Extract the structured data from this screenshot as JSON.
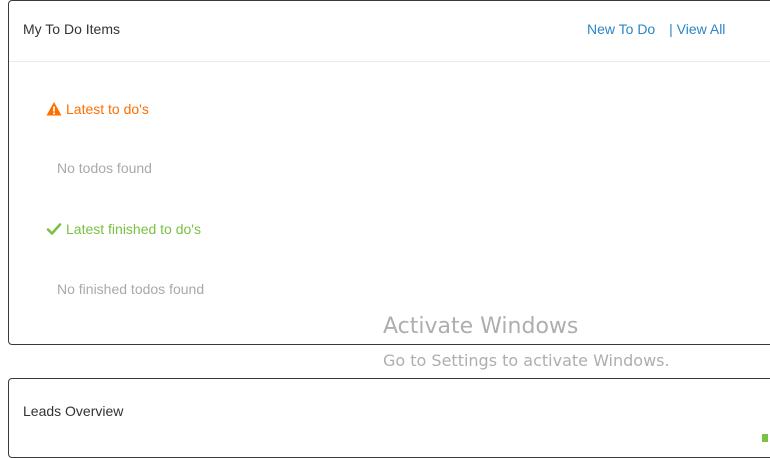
{
  "todo_panel": {
    "title": "My To Do Items",
    "new_link": "New To Do",
    "separator": "|",
    "view_all_link": "View All",
    "latest": {
      "heading": "Latest to do's",
      "icon": "warning-triangle-icon",
      "empty_text": "No todos found",
      "color": "#ff6f00"
    },
    "finished": {
      "heading": "Latest finished to do's",
      "icon": "checkmark-icon",
      "empty_text": "No finished todos found",
      "color": "#7ac143"
    }
  },
  "leads_panel": {
    "title": "Leads Overview"
  },
  "watermark": {
    "title": "Activate Windows",
    "subtitle": "Go to Settings to activate Windows."
  },
  "colors": {
    "link": "#2b86c6",
    "muted": "#a9a9a9"
  }
}
